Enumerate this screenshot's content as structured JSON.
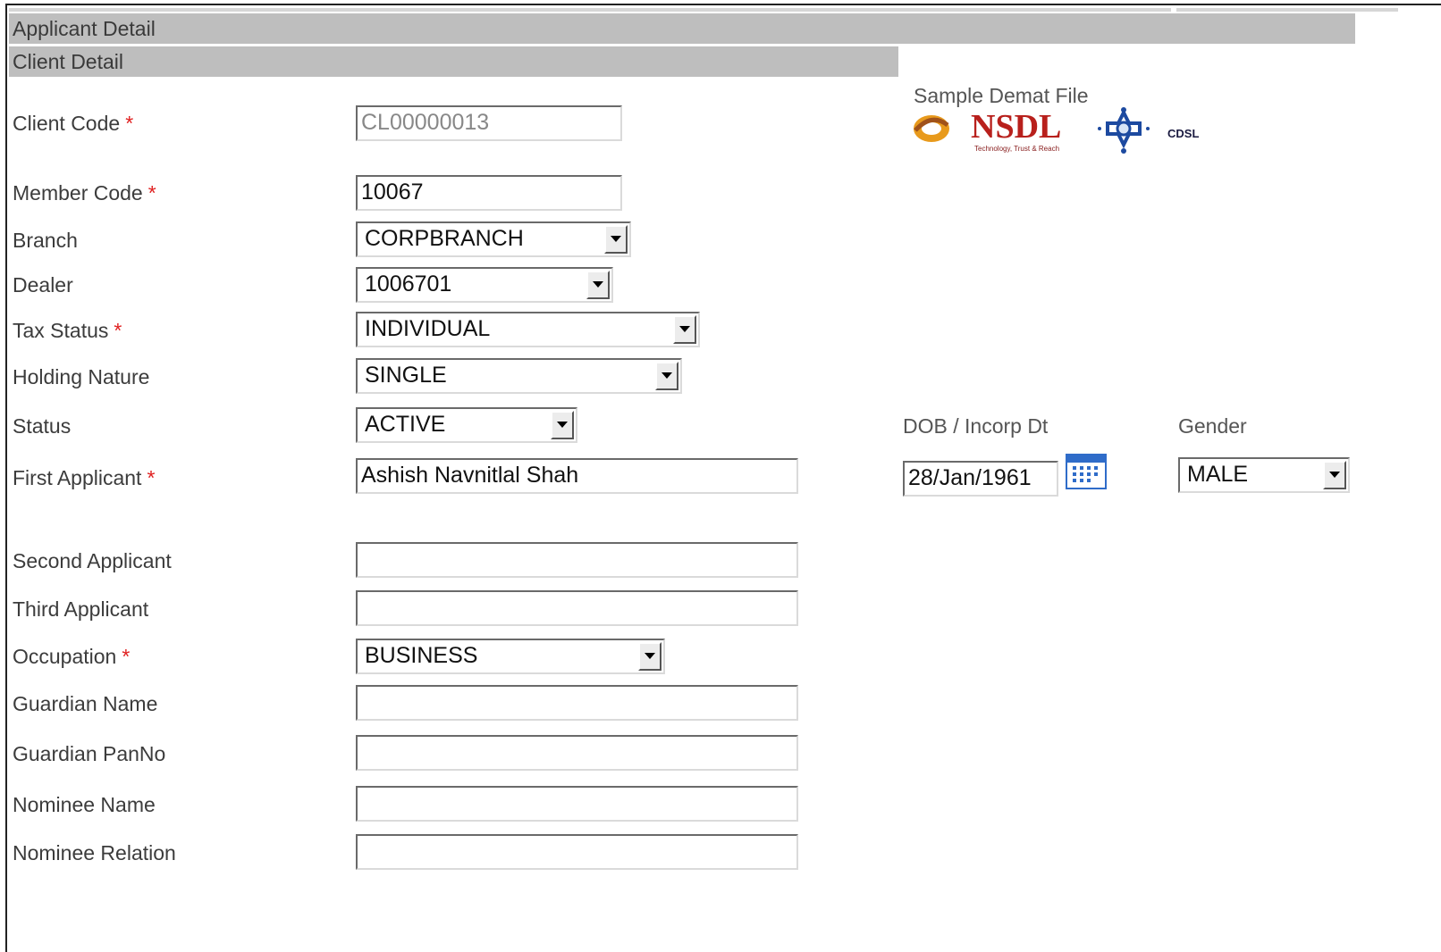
{
  "headers": {
    "applicant_detail": "Applicant Detail",
    "client_detail": "Client Detail"
  },
  "sample_demat": {
    "label": "Sample Demat File",
    "nsdl_text": "NSDL",
    "nsdl_tagline": "Technology, Trust & Reach",
    "cdsl_text": "CDSL"
  },
  "fields": {
    "client_code": {
      "label": "Client Code",
      "value": "CL00000013"
    },
    "member_code": {
      "label": "Member Code",
      "value": "10067"
    },
    "branch": {
      "label": "Branch",
      "value": "CORPBRANCH"
    },
    "dealer": {
      "label": "Dealer",
      "value": "1006701"
    },
    "tax_status": {
      "label": "Tax Status",
      "value": "INDIVIDUAL"
    },
    "holding_nature": {
      "label": "Holding Nature",
      "value": "SINGLE"
    },
    "status": {
      "label": "Status",
      "value": "ACTIVE"
    },
    "first_applicant": {
      "label": "First Applicant",
      "value": "Ashish Navnitlal Shah"
    },
    "second_applicant": {
      "label": "Second Applicant",
      "value": ""
    },
    "third_applicant": {
      "label": "Third Applicant",
      "value": ""
    },
    "occupation": {
      "label": "Occupation",
      "value": "BUSINESS"
    },
    "guardian_name": {
      "label": "Guardian Name",
      "value": ""
    },
    "guardian_panno": {
      "label": "Guardian PanNo",
      "value": ""
    },
    "nominee_name": {
      "label": "Nominee Name",
      "value": ""
    },
    "nominee_relation": {
      "label": "Nominee Relation",
      "value": ""
    },
    "dob": {
      "label": "DOB / Incorp Dt",
      "value": "28/Jan/1961"
    },
    "gender": {
      "label": "Gender",
      "value": "MALE"
    }
  },
  "required_marker": "*",
  "colors": {
    "header_bg": "#bebebe",
    "required": "#e02020",
    "nsdl_red": "#b8201c",
    "cdsl_blue": "#1d4aa0",
    "calendar_blue": "#2f6cc9"
  },
  "icons": {
    "dropdown": "chevron-down-icon",
    "calendar": "calendar-icon"
  }
}
